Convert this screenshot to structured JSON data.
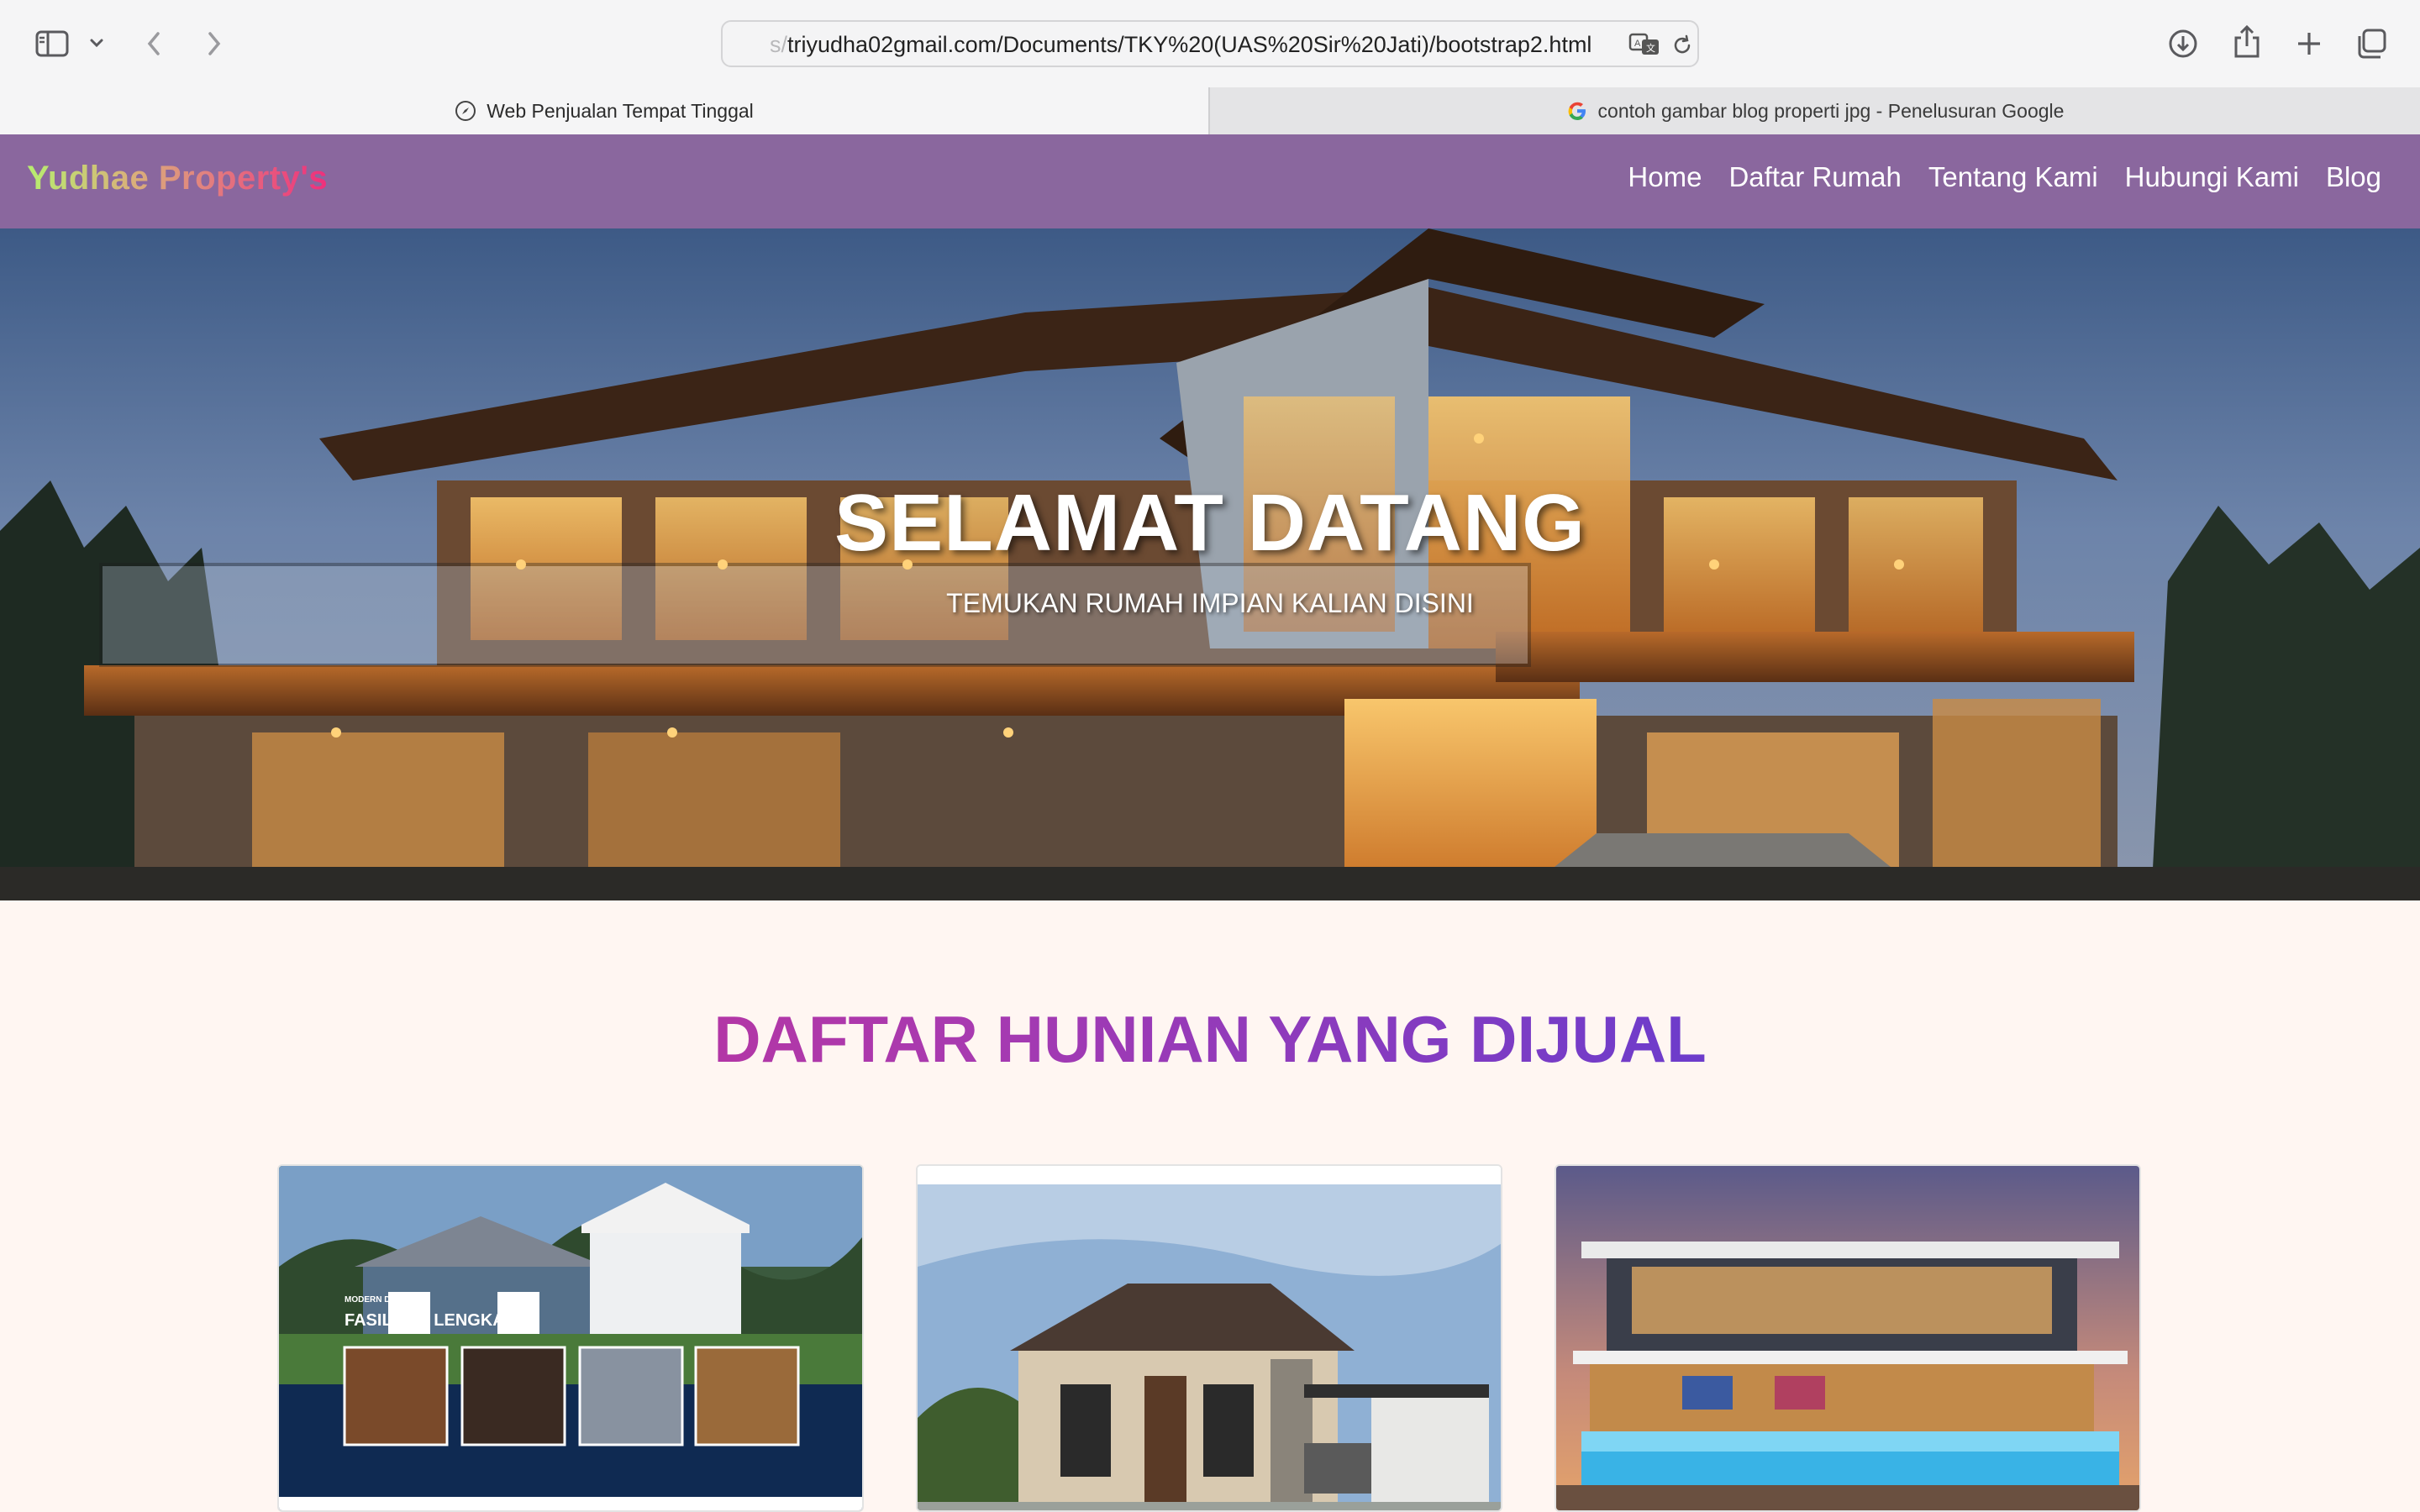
{
  "browser": {
    "url_prefix": "s/",
    "url": "triyudha02gmail.com/Documents/TKY%20(UAS%20Sir%20Jati)/bootstrap2.html",
    "tabs": [
      {
        "label": "Web Penjualan Tempat Tinggal",
        "icon": "compass-icon",
        "active": true
      },
      {
        "label": "contoh gambar blog properti jpg - Penelusuran Google",
        "icon": "google-icon",
        "active": false
      }
    ]
  },
  "navbar": {
    "brand": "Yudhae Property's",
    "links": [
      "Home",
      "Daftar Rumah",
      "Tentang Kami",
      "Hubungi Kami",
      "Blog"
    ],
    "background": "#8a679e"
  },
  "hero": {
    "title": "SELAMAT DATANG",
    "subtitle": "TEMUKAN RUMAH IMPIAN KALIAN DISINI"
  },
  "listing": {
    "title": "DAFTAR HUNIAN YANG DIJUAL",
    "cards": [
      {
        "image": "house-brochure-image",
        "overlay_small": "MODERN DAN",
        "overlay_large": "FASILITAS LENGKAP"
      },
      {
        "image": "modern-house-image"
      },
      {
        "image": "villa-pool-image"
      }
    ]
  },
  "colors": {
    "page_background": "#fff6f2",
    "title_gradient_start": "#d12c89",
    "title_gradient_end": "#5e3ed6"
  }
}
